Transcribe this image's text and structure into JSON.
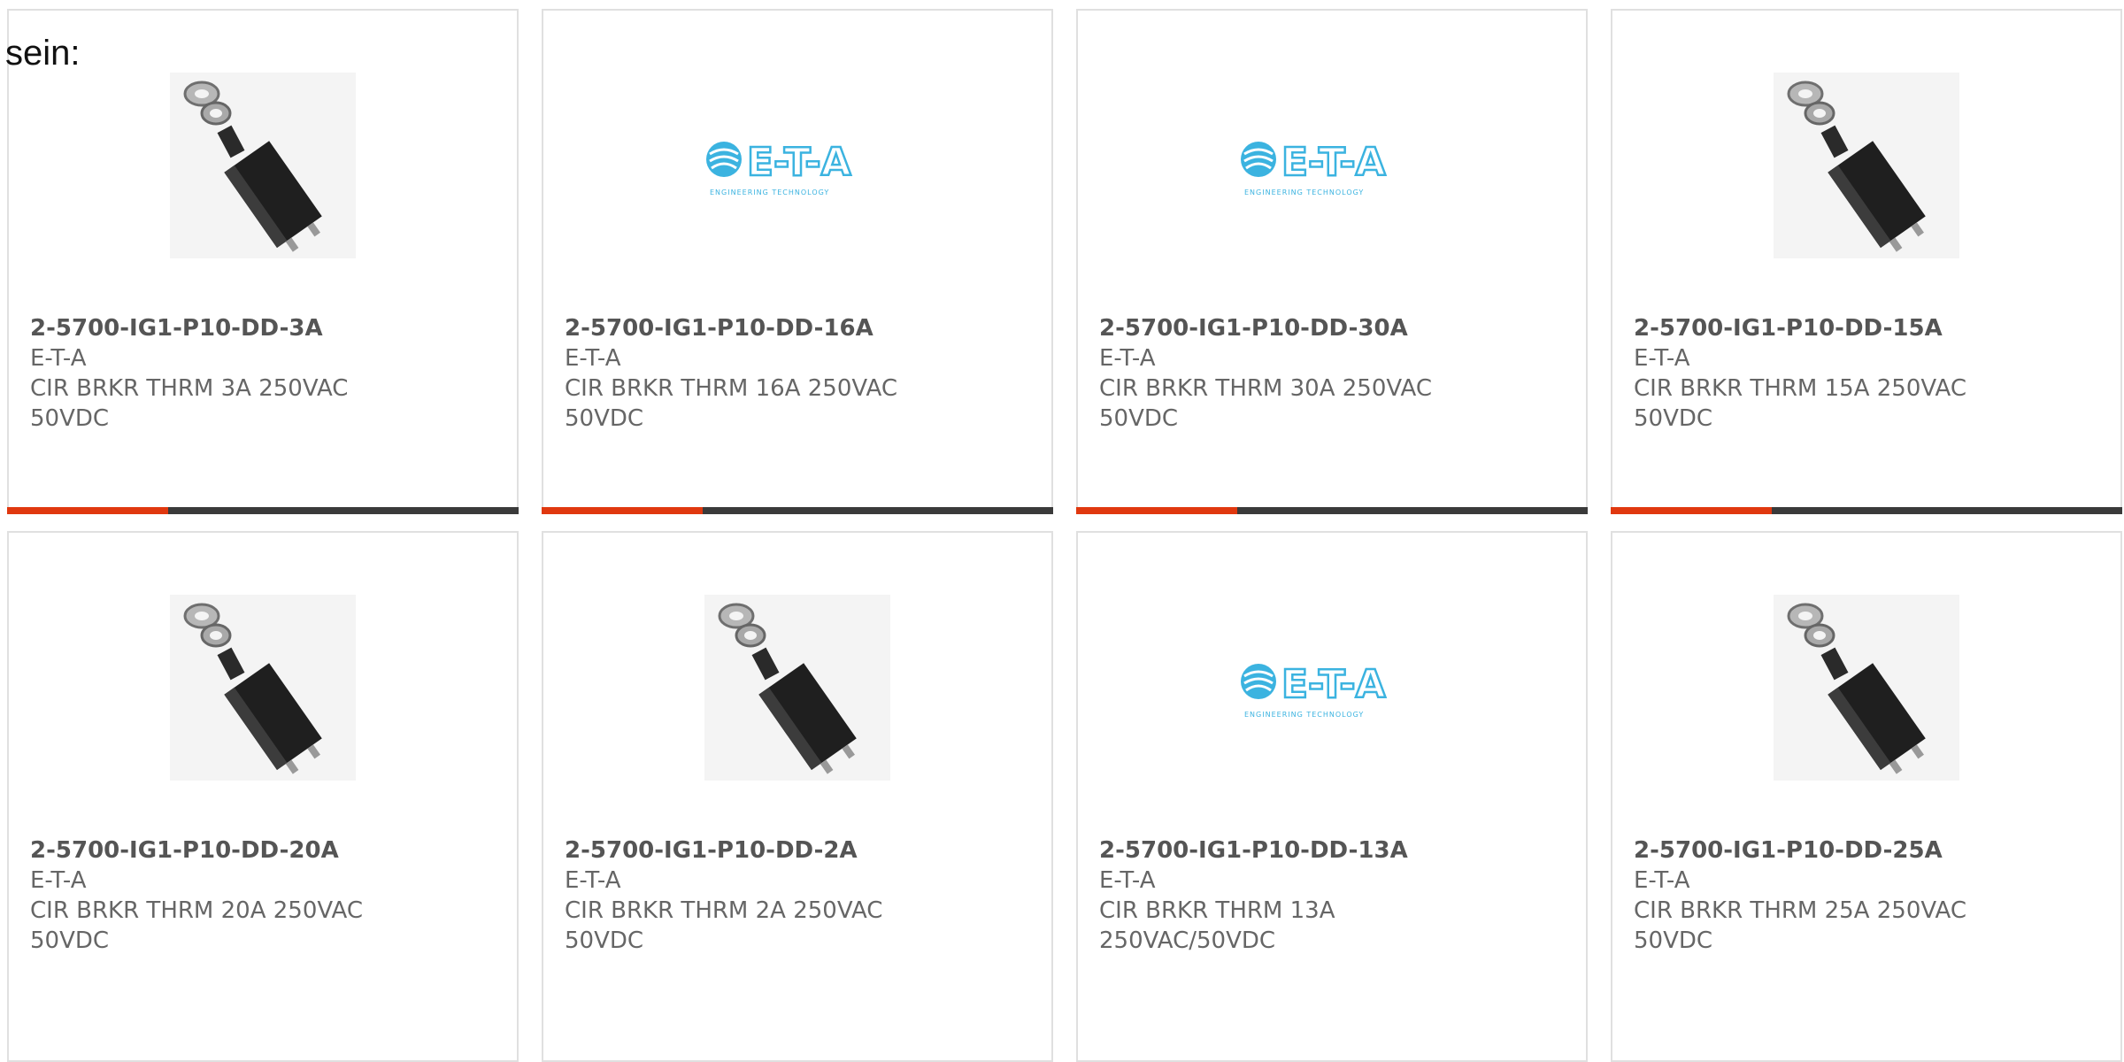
{
  "intro_text": "sein:",
  "accent_color": "#e0380f",
  "bar_color": "#3a3a3a",
  "products": [
    {
      "part_number": "2-5700-IG1-P10-DD-3A",
      "manufacturer": "E-T-A",
      "description": "CIR BRKR THRM 3A 250VAC 50VDC",
      "image": "circuit-breaker"
    },
    {
      "part_number": "2-5700-IG1-P10-DD-16A",
      "manufacturer": "E-T-A",
      "description": "CIR BRKR THRM 16A 250VAC 50VDC",
      "image": "eta-logo",
      "logo_text": "E-T-A",
      "logo_subtext": "ENGINEERING TECHNOLOGY"
    },
    {
      "part_number": "2-5700-IG1-P10-DD-30A",
      "manufacturer": "E-T-A",
      "description": "CIR BRKR THRM 30A 250VAC 50VDC",
      "image": "eta-logo",
      "logo_text": "E-T-A",
      "logo_subtext": "ENGINEERING TECHNOLOGY"
    },
    {
      "part_number": "2-5700-IG1-P10-DD-15A",
      "manufacturer": "E-T-A",
      "description": "CIR BRKR THRM 15A 250VAC 50VDC",
      "image": "circuit-breaker"
    },
    {
      "part_number": "2-5700-IG1-P10-DD-20A",
      "manufacturer": "E-T-A",
      "description": "CIR BRKR THRM 20A 250VAC 50VDC",
      "image": "circuit-breaker"
    },
    {
      "part_number": "2-5700-IG1-P10-DD-2A",
      "manufacturer": "E-T-A",
      "description": "CIR BRKR THRM 2A 250VAC 50VDC",
      "image": "circuit-breaker"
    },
    {
      "part_number": "2-5700-IG1-P10-DD-13A",
      "manufacturer": "E-T-A",
      "description": "CIR BRKR THRM 13A 250VAC/50VDC",
      "image": "eta-logo",
      "logo_text": "E-T-A",
      "logo_subtext": "ENGINEERING TECHNOLOGY"
    },
    {
      "part_number": "2-5700-IG1-P10-DD-25A",
      "manufacturer": "E-T-A",
      "description": "CIR BRKR THRM 25A 250VAC 50VDC",
      "image": "circuit-breaker"
    }
  ]
}
